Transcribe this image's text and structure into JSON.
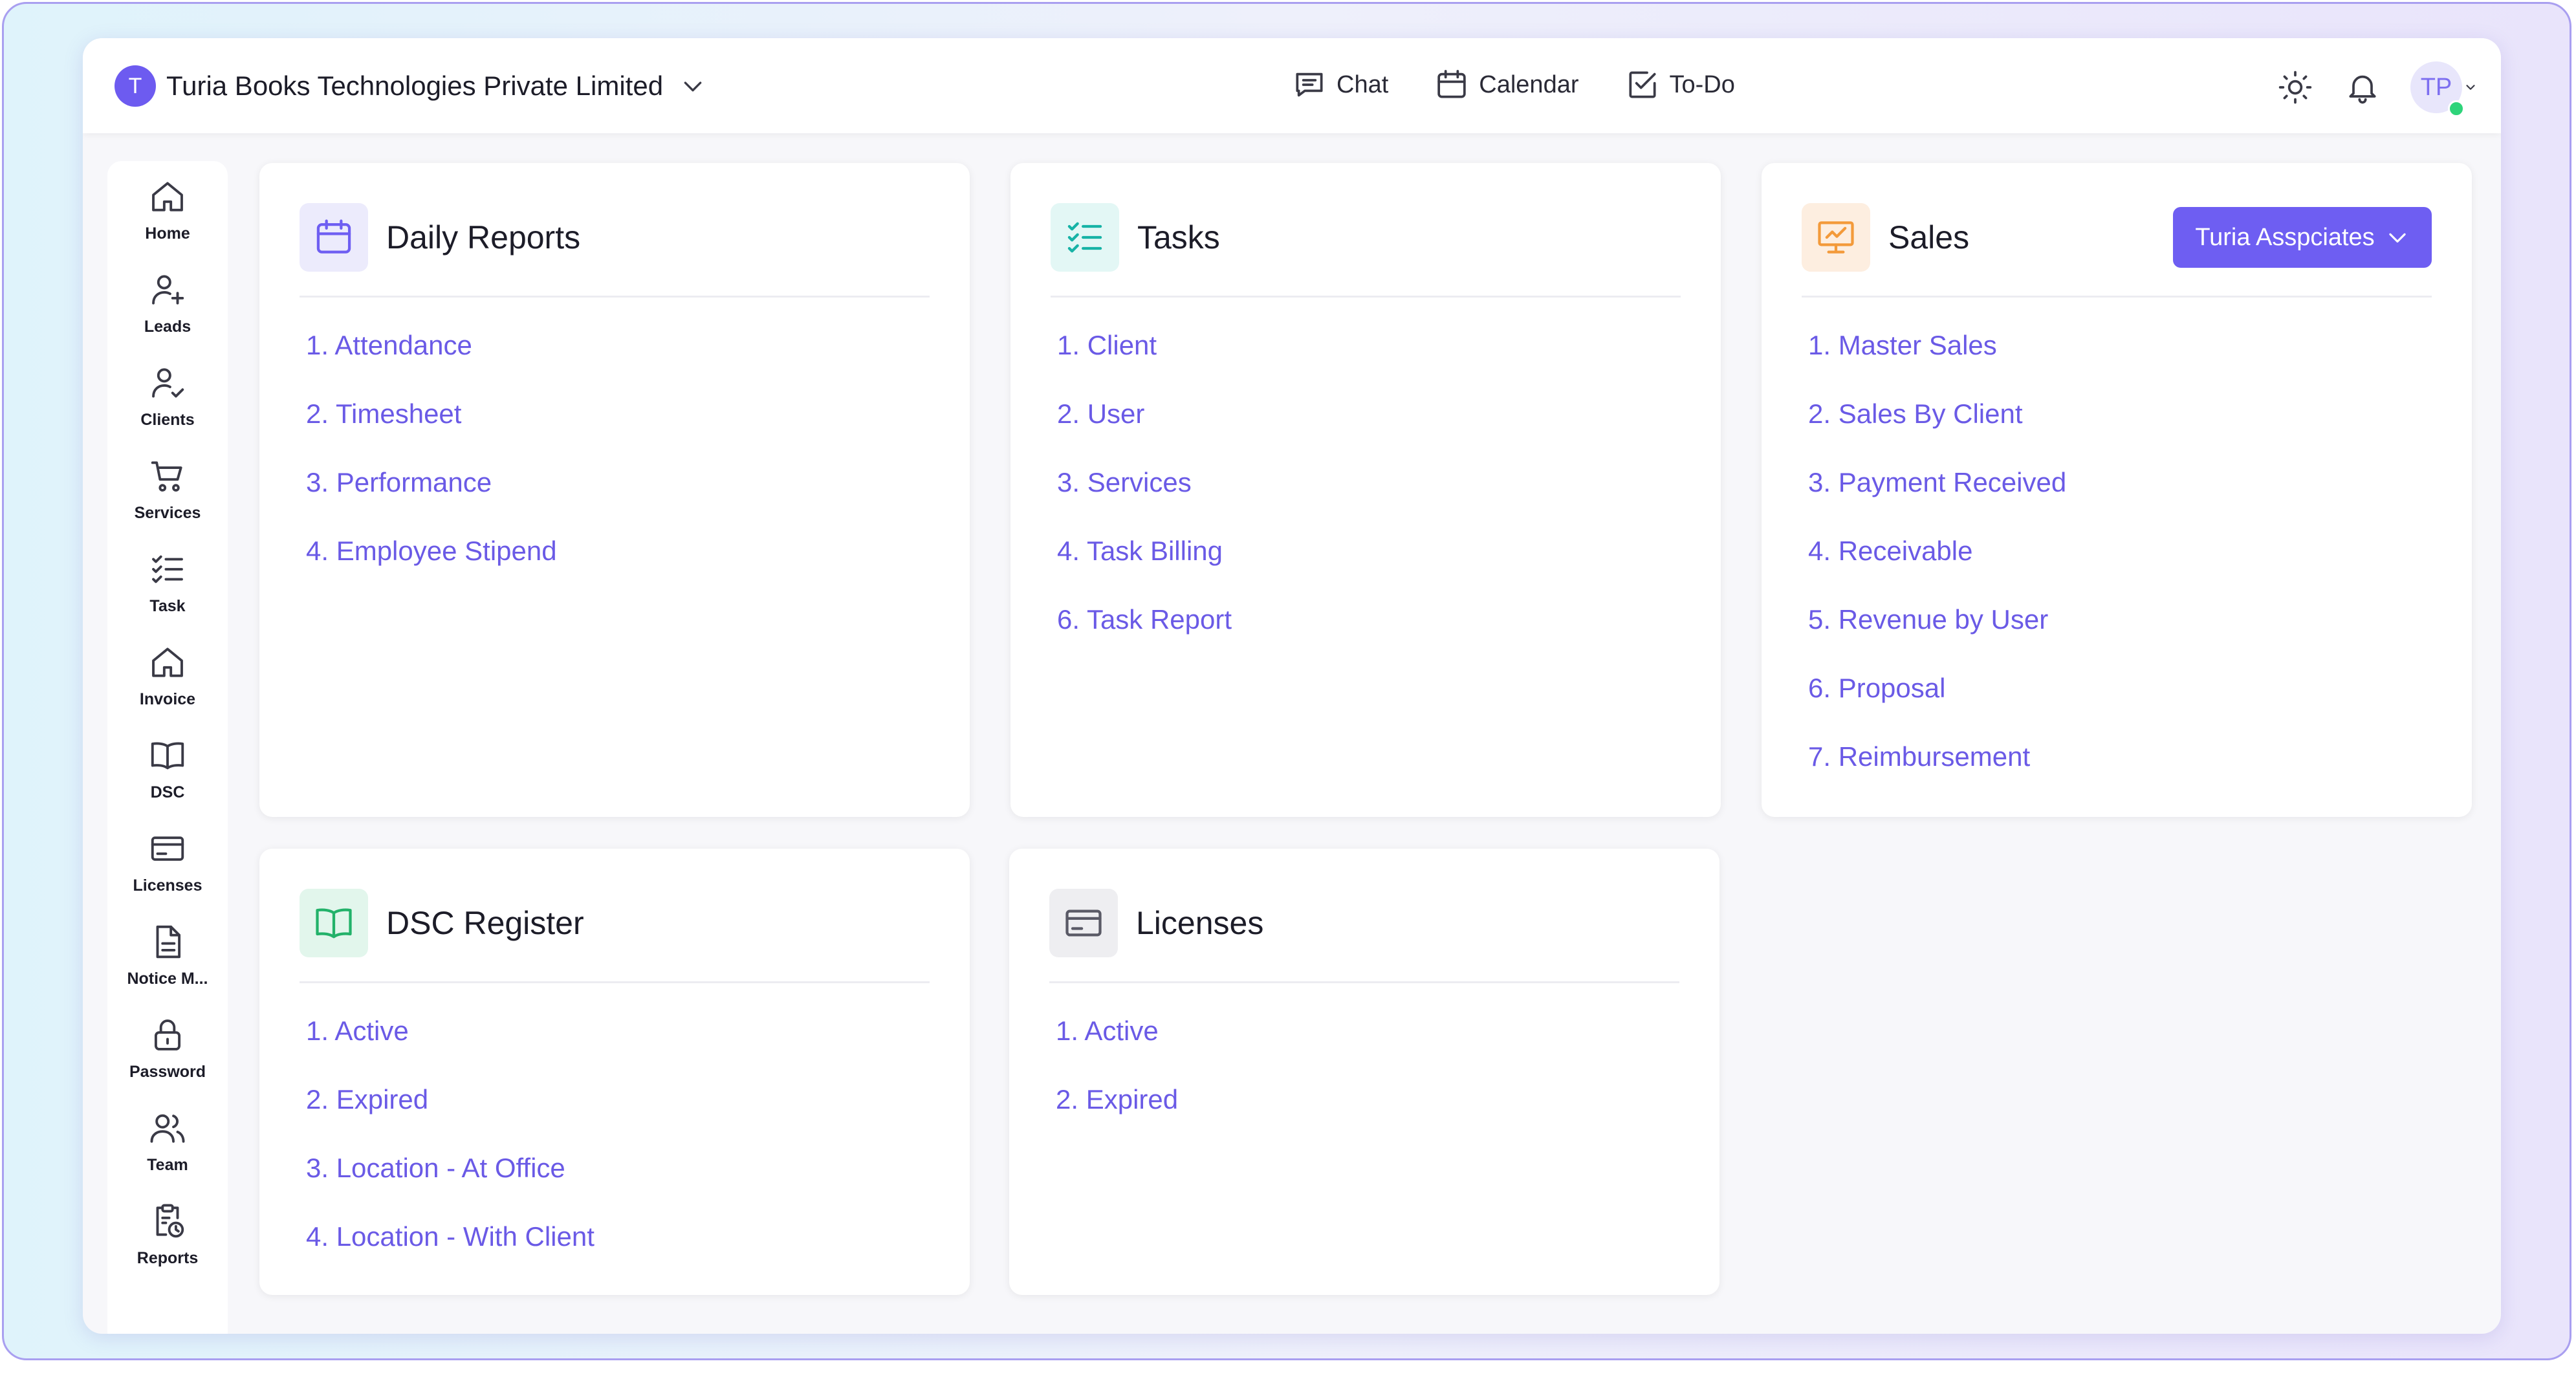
{
  "header": {
    "org_initial": "T",
    "org_name": "Turia Books Technologies Private Limited",
    "nav": [
      {
        "label": "Chat",
        "icon": "chat-icon"
      },
      {
        "label": "Calendar",
        "icon": "calendar-icon"
      },
      {
        "label": "To-Do",
        "icon": "todo-icon"
      }
    ],
    "user_initials": "TP"
  },
  "sidebar": {
    "items": [
      {
        "label": "Home",
        "icon": "home-icon"
      },
      {
        "label": "Leads",
        "icon": "user-add-icon"
      },
      {
        "label": "Clients",
        "icon": "user-check-icon"
      },
      {
        "label": "Services",
        "icon": "cart-icon"
      },
      {
        "label": "Task",
        "icon": "checklist-icon"
      },
      {
        "label": "Invoice",
        "icon": "home-icon"
      },
      {
        "label": "DSC",
        "icon": "book-icon"
      },
      {
        "label": "Licenses",
        "icon": "card-icon"
      },
      {
        "label": "Notice M...",
        "icon": "document-icon"
      },
      {
        "label": "Password",
        "icon": "lock-icon"
      },
      {
        "label": "Team",
        "icon": "team-icon"
      },
      {
        "label": "Reports",
        "icon": "clipboard-clock-icon"
      }
    ]
  },
  "cards": {
    "daily_reports": {
      "title": "Daily Reports",
      "icon": "calendar-icon",
      "items": [
        "1.  Attendance",
        "2. Timesheet",
        "3. Performance",
        "4. Employee Stipend"
      ]
    },
    "tasks": {
      "title": "Tasks",
      "icon": "checklist-icon",
      "items": [
        "1. Client",
        "2. User",
        "3. Services",
        "4. Task Billing",
        "6. Task Report"
      ]
    },
    "sales": {
      "title": "Sales",
      "icon": "presentation-chart-icon",
      "dropdown": "Turia Asspciates",
      "items": [
        "1. Master Sales",
        "2. Sales By Client",
        "3. Payment Received",
        "4. Receivable",
        "5. Revenue by User",
        "6. Proposal",
        "7. Reimbursement"
      ]
    },
    "dsc_register": {
      "title": "DSC Register",
      "icon": "book-icon",
      "items": [
        "1. Active",
        "2. Expired",
        "3. Location - At Office",
        "4. Location - With Client"
      ]
    },
    "licenses": {
      "title": "Licenses",
      "icon": "card-icon",
      "items": [
        "1. Active",
        "2. Expired"
      ]
    }
  },
  "colors": {
    "accent": "#6e5ef2",
    "link": "#6a5ae6",
    "status_online": "#2ed47a"
  }
}
